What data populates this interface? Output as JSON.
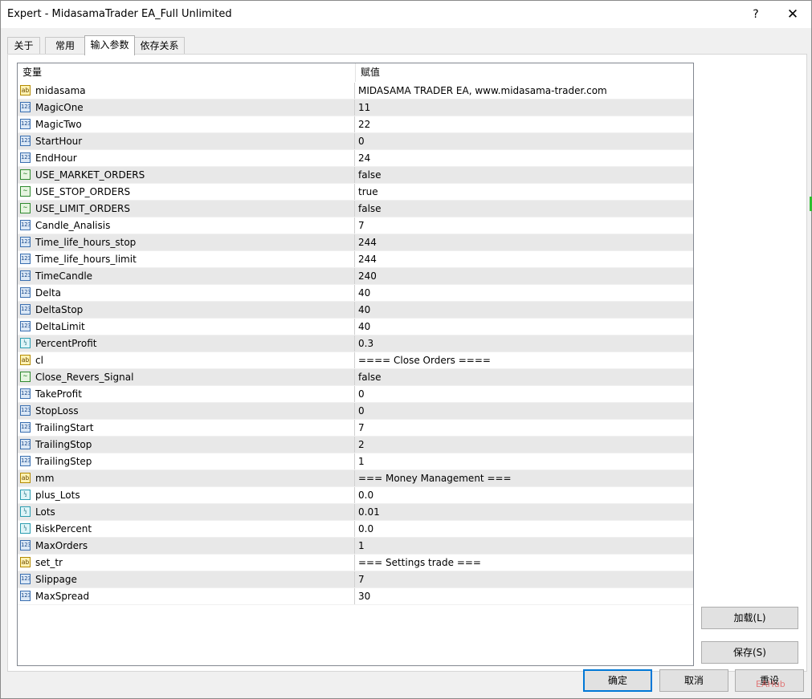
{
  "window": {
    "title": "Expert - MidasamaTrader EA_Full Unlimited",
    "help": "?",
    "close": "✕"
  },
  "tabs": [
    {
      "label": "关于",
      "active": false
    },
    {
      "label": "常用",
      "active": false
    },
    {
      "label": "输入参数",
      "active": true
    },
    {
      "label": "依存关系",
      "active": false
    }
  ],
  "grid": {
    "col_variable": "变量",
    "col_value": "赋值",
    "rows": [
      {
        "name": "midasama",
        "value": "MIDASAMA TRADER EA, www.midasama-trader.com",
        "type": "string",
        "icon": "ab"
      },
      {
        "name": "MagicOne",
        "value": "11",
        "type": "int",
        "icon": "123"
      },
      {
        "name": "MagicTwo",
        "value": "22",
        "type": "int",
        "icon": "123"
      },
      {
        "name": "StartHour",
        "value": "0",
        "type": "int",
        "icon": "123"
      },
      {
        "name": "EndHour",
        "value": "24",
        "type": "int",
        "icon": "123"
      },
      {
        "name": "USE_MARKET_ORDERS",
        "value": "false",
        "type": "bool",
        "icon": "∼"
      },
      {
        "name": "USE_STOP_ORDERS",
        "value": "true",
        "type": "bool",
        "icon": "∼"
      },
      {
        "name": "USE_LIMIT_ORDERS",
        "value": "false",
        "type": "bool",
        "icon": "∼"
      },
      {
        "name": "Candle_Analisis",
        "value": "7",
        "type": "int",
        "icon": "123"
      },
      {
        "name": "Time_life_hours_stop",
        "value": "244",
        "type": "int",
        "icon": "123"
      },
      {
        "name": "Time_life_hours_limit",
        "value": "244",
        "type": "int",
        "icon": "123"
      },
      {
        "name": "TimeCandle",
        "value": "240",
        "type": "int",
        "icon": "123"
      },
      {
        "name": "Delta",
        "value": "40",
        "type": "int",
        "icon": "123"
      },
      {
        "name": "DeltaStop",
        "value": "40",
        "type": "int",
        "icon": "123"
      },
      {
        "name": "DeltaLimit",
        "value": "40",
        "type": "int",
        "icon": "123"
      },
      {
        "name": "PercentProfit",
        "value": "0.3",
        "type": "double",
        "icon": "½"
      },
      {
        "name": "cl",
        "value": "==== Close Orders ====",
        "type": "string",
        "icon": "ab"
      },
      {
        "name": "Close_Revers_Signal",
        "value": "false",
        "type": "bool",
        "icon": "∼"
      },
      {
        "name": "TakeProfit",
        "value": "0",
        "type": "int",
        "icon": "123"
      },
      {
        "name": "StopLoss",
        "value": "0",
        "type": "int",
        "icon": "123"
      },
      {
        "name": "TrailingStart",
        "value": "7",
        "type": "int",
        "icon": "123"
      },
      {
        "name": "TrailingStop",
        "value": "2",
        "type": "int",
        "icon": "123"
      },
      {
        "name": "TrailingStep",
        "value": "1",
        "type": "int",
        "icon": "123"
      },
      {
        "name": "mm",
        "value": "=== Money Management ===",
        "type": "string",
        "icon": "ab"
      },
      {
        "name": "plus_Lots",
        "value": "0.0",
        "type": "double",
        "icon": "½"
      },
      {
        "name": "Lots",
        "value": "0.01",
        "type": "double",
        "icon": "½"
      },
      {
        "name": "RiskPercent",
        "value": "0.0",
        "type": "double",
        "icon": "½"
      },
      {
        "name": "MaxOrders",
        "value": "1",
        "type": "int",
        "icon": "123"
      },
      {
        "name": "set_tr",
        "value": "=== Settings trade ===",
        "type": "string",
        "icon": "ab"
      },
      {
        "name": "Slippage",
        "value": "7",
        "type": "int",
        "icon": "123"
      },
      {
        "name": "MaxSpread",
        "value": "30",
        "type": "int",
        "icon": "123"
      }
    ]
  },
  "buttons": {
    "load": "加载(L)",
    "save": "保存(S)",
    "ok": "确定",
    "cancel": "取消",
    "reset": "重设"
  },
  "watermark": "EAHub"
}
